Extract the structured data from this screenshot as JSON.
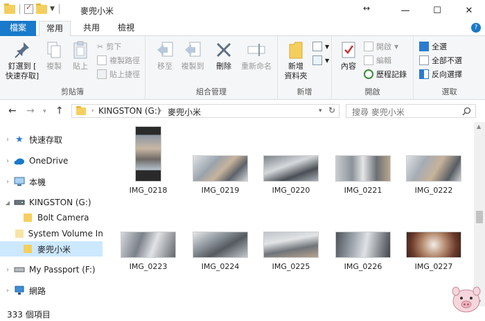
{
  "window": {
    "title": "麥兜小米"
  },
  "tabs": {
    "file": "檔案",
    "home": "常用",
    "share": "共用",
    "view": "檢視"
  },
  "ribbon": {
    "clipboard": {
      "label": "剪貼簿",
      "pin": "釘選到 [\n快速存取]",
      "copy": "複製",
      "paste": "貼上",
      "cut": "剪下",
      "copy_path": "複製路徑",
      "paste_shortcut": "貼上捷徑"
    },
    "organize": {
      "label": "組合管理",
      "move_to": "移至",
      "copy_to": "複製到",
      "delete": "刪除",
      "rename": "重新命名"
    },
    "new": {
      "label": "新增",
      "new_folder": "新增\n資料夾"
    },
    "open": {
      "label": "開啟",
      "properties": "內容",
      "open": "開啟",
      "edit": "編輯",
      "history": "歷程記錄"
    },
    "select": {
      "label": "選取",
      "select_all": "全選",
      "select_none": "全部不選",
      "invert": "反向選擇"
    }
  },
  "address": {
    "drive": "KINGSTON (G:)",
    "folder": "麥兜小米",
    "search_placeholder": "搜尋 麥兜小米"
  },
  "nav": {
    "quick_access": "快速存取",
    "onedrive": "OneDrive",
    "this_pc": "本機",
    "kingston": "KINGSTON (G:)",
    "bolt": "Bolt Camera",
    "sysvol": "System Volume Information",
    "mi": "麥兜小米",
    "passport": "My Passport (F:)",
    "network": "網路"
  },
  "files": [
    "IMG_0218",
    "IMG_0219",
    "IMG_0220",
    "IMG_0221",
    "IMG_0222",
    "IMG_0223",
    "IMG_0224",
    "IMG_0225",
    "IMG_0226",
    "IMG_0227"
  ],
  "status": {
    "count": "333 個項目"
  },
  "colors": {
    "accent": "#1979ca",
    "folder": "#f4cf5e",
    "selected": "#cce8ff"
  }
}
